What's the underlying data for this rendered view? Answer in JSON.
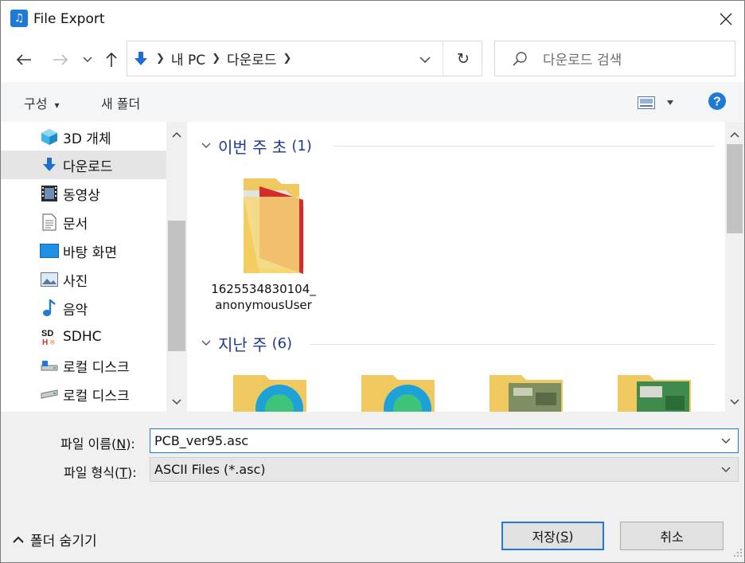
{
  "window": {
    "title": "File Export"
  },
  "nav": {
    "back_icon": "back-arrow-icon",
    "forward_icon": "forward-arrow-icon",
    "up_icon": "up-arrow-icon",
    "recent_icon": "chevron-down-icon"
  },
  "address": {
    "crumbs": [
      "내 PC",
      "다운로드"
    ],
    "refresh_icon": "refresh-icon"
  },
  "search": {
    "placeholder": "다운로드 검색"
  },
  "toolbar": {
    "organize": "구성",
    "organize_caret": "▾",
    "new_folder": "새 폴더"
  },
  "sidebar": {
    "items": [
      {
        "label": "3D 개체",
        "icon": "3d-objects-icon"
      },
      {
        "label": "다운로드",
        "icon": "download-icon"
      },
      {
        "label": "동영상",
        "icon": "video-icon"
      },
      {
        "label": "문서",
        "icon": "document-icon"
      },
      {
        "label": "바탕 화면",
        "icon": "desktop-icon"
      },
      {
        "label": "사진",
        "icon": "pictures-icon"
      },
      {
        "label": "음악",
        "icon": "music-icon"
      },
      {
        "label": "SDHC",
        "icon": "sd-card-icon"
      },
      {
        "label": "로컬 디스크",
        "icon": "local-disk-icon"
      },
      {
        "label": "로컬 디스크",
        "icon": "local-disk-icon"
      }
    ]
  },
  "groups": [
    {
      "title": "이번 주 초",
      "count": "(1)"
    },
    {
      "title": "지난 주",
      "count": "(6)"
    }
  ],
  "files": [
    {
      "name_line1": "1625534830104_",
      "name_line2": "anonymousUser"
    }
  ],
  "form": {
    "filename_label": "파일 이름(",
    "filename_key": "N",
    "filename_label_end": "):",
    "filename_value": "PCB_ver95.asc",
    "filetype_label": "파일 형식(",
    "filetype_key": "T",
    "filetype_label_end": "):",
    "filetype_value": "ASCII Files (*.asc)"
  },
  "footer": {
    "hide_folders": "폴더 숨기기",
    "save_label": "저장(",
    "save_key": "S",
    "save_label_end": ")",
    "cancel_label": "취소"
  },
  "colors": {
    "accent": "#1e7ad6",
    "group_title": "#1e3a8a",
    "selection": "#e5e5e5"
  }
}
